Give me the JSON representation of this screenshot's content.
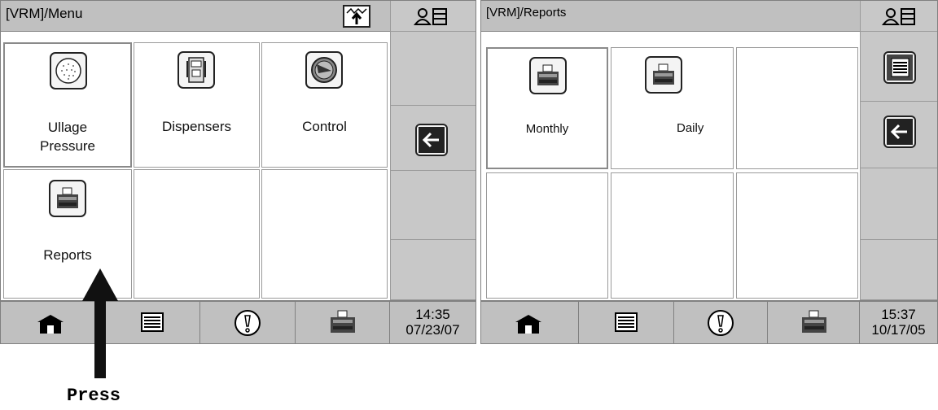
{
  "left_screen": {
    "title": "[VRM]/Menu",
    "tiles": [
      "Ullage\nPressure",
      "Dispensers",
      "Control",
      "Reports"
    ],
    "clock": {
      "time": "14:35",
      "date": "07/23/07"
    },
    "icons": {
      "top_right": "printer-paper-up-icon",
      "person": "person-list-icon",
      "back": "arrow-left-icon"
    }
  },
  "right_screen": {
    "title": "[VRM]/Reports",
    "tiles": [
      "Monthly",
      "Daily"
    ],
    "clock": {
      "time": "15:37",
      "date": "10/17/05"
    },
    "icons": {
      "person": "person-list-icon",
      "menu": "list-icon",
      "back": "arrow-left-icon"
    }
  },
  "bottom_nav_icons": [
    "home-icon",
    "list-icon",
    "alarm-icon",
    "printer-icon"
  ],
  "annotation": {
    "label": "Press"
  }
}
